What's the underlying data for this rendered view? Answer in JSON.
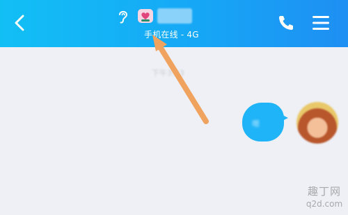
{
  "header": {
    "status_text": "手机在线 - 4G",
    "icons": {
      "back": "chevron-left-icon",
      "listen_mode": "ear-icon",
      "pet": "pet-badge-icon",
      "call": "phone-icon",
      "menu": "hamburger-menu-icon"
    }
  },
  "chat": {
    "time_label": "下午3:23",
    "messages": [
      {
        "sender": "me",
        "text": "嗯"
      }
    ]
  },
  "watermark": {
    "line1": "趣丁网",
    "line2": "q2d.com"
  },
  "colors": {
    "header_start": "#12bff5",
    "header_end": "#1e8ff3",
    "bubble": "#1fb4f8",
    "background": "#eef0f5",
    "arrow": "#f0a35e"
  }
}
